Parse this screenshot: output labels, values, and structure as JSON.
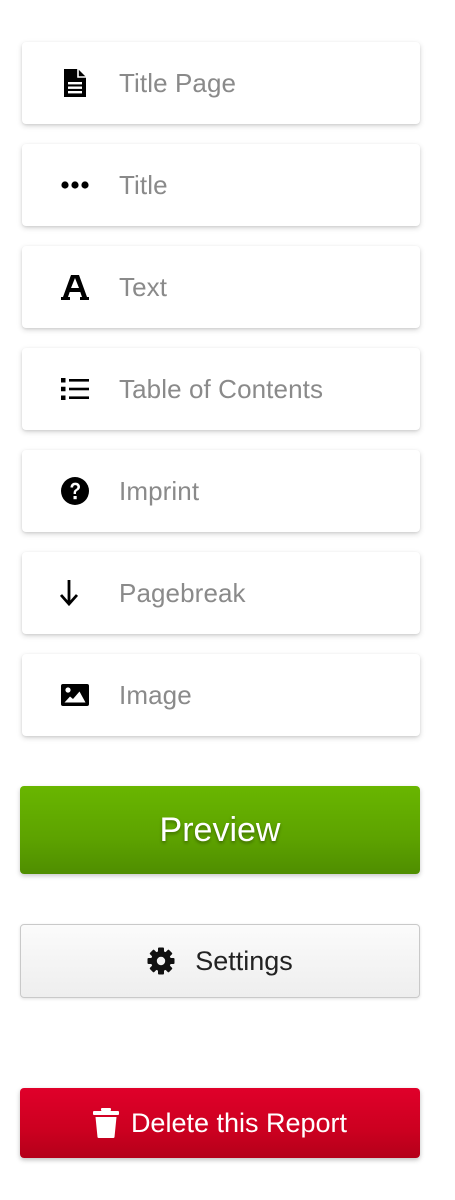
{
  "items": [
    {
      "label": "Title Page",
      "icon": "file-text-icon"
    },
    {
      "label": "Title",
      "icon": "ellipsis-icon"
    },
    {
      "label": "Text",
      "icon": "font-a-icon"
    },
    {
      "label": "Table of Contents",
      "icon": "list-icon"
    },
    {
      "label": "Imprint",
      "icon": "question-circle-icon"
    },
    {
      "label": "Pagebreak",
      "icon": "arrow-down-icon"
    },
    {
      "label": "Image",
      "icon": "image-icon"
    }
  ],
  "buttons": {
    "preview_label": "Preview",
    "settings_label": "Settings",
    "settings_icon": "gear-icon",
    "delete_label": "Delete this Report",
    "delete_icon": "trash-icon"
  },
  "colors": {
    "item_label": "#8a8a8a",
    "preview_bg": "#5da200",
    "delete_bg": "#cc0020",
    "settings_bg": "#f2f2f2"
  }
}
